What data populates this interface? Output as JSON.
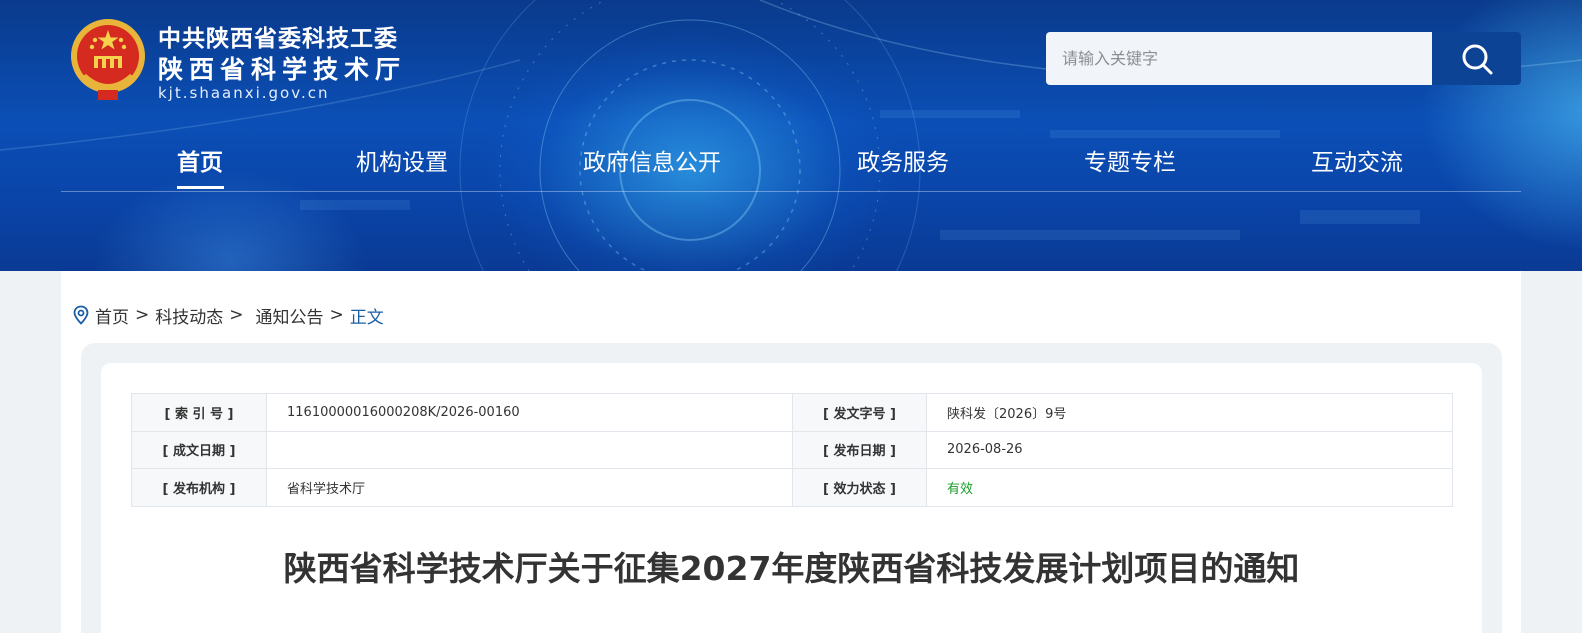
{
  "header": {
    "title_line1": "中共陕西省委科技工委",
    "title_line2": "陕西省科学技术厅",
    "url": "kjt.shaanxi.gov.cn"
  },
  "search": {
    "placeholder": "请输入关键字"
  },
  "nav": [
    {
      "label": "首页",
      "active": true
    },
    {
      "label": "机构设置"
    },
    {
      "label": "政府信息公开"
    },
    {
      "label": "政务服务"
    },
    {
      "label": "专题专栏"
    },
    {
      "label": "互动交流"
    }
  ],
  "breadcrumb": [
    {
      "label": "首页"
    },
    {
      "label": "科技动态"
    },
    {
      "label": "通知公告"
    },
    {
      "label": "正文"
    }
  ],
  "meta": {
    "index_label": "[ 索 引 号 ]",
    "index_value": "11610000016000208K/2026-00160",
    "docno_label": "[ 发文字号 ]",
    "docno_value": "陕科发〔2026〕9号",
    "created_label": "[ 成文日期 ]",
    "created_value": "",
    "published_label": "[ 发布日期 ]",
    "published_value": "2026-08-26",
    "org_label": "[ 发布机构 ]",
    "org_value": "省科学技术厅",
    "status_label": "[ 效力状态 ]",
    "status_value": "有效"
  },
  "article": {
    "title": "陕西省科学技术厅关于征集2027年度陕西省科技发展计划项目的通知"
  },
  "colors": {
    "header_blue": "#0b4fb6",
    "search_button": "#0d4394",
    "breadcrumb_current": "#1a5ea8",
    "status_valid": "#1a9e2a"
  },
  "icons": {
    "logo": "national-emblem-icon",
    "search": "search-icon",
    "location": "location-pin-icon"
  }
}
